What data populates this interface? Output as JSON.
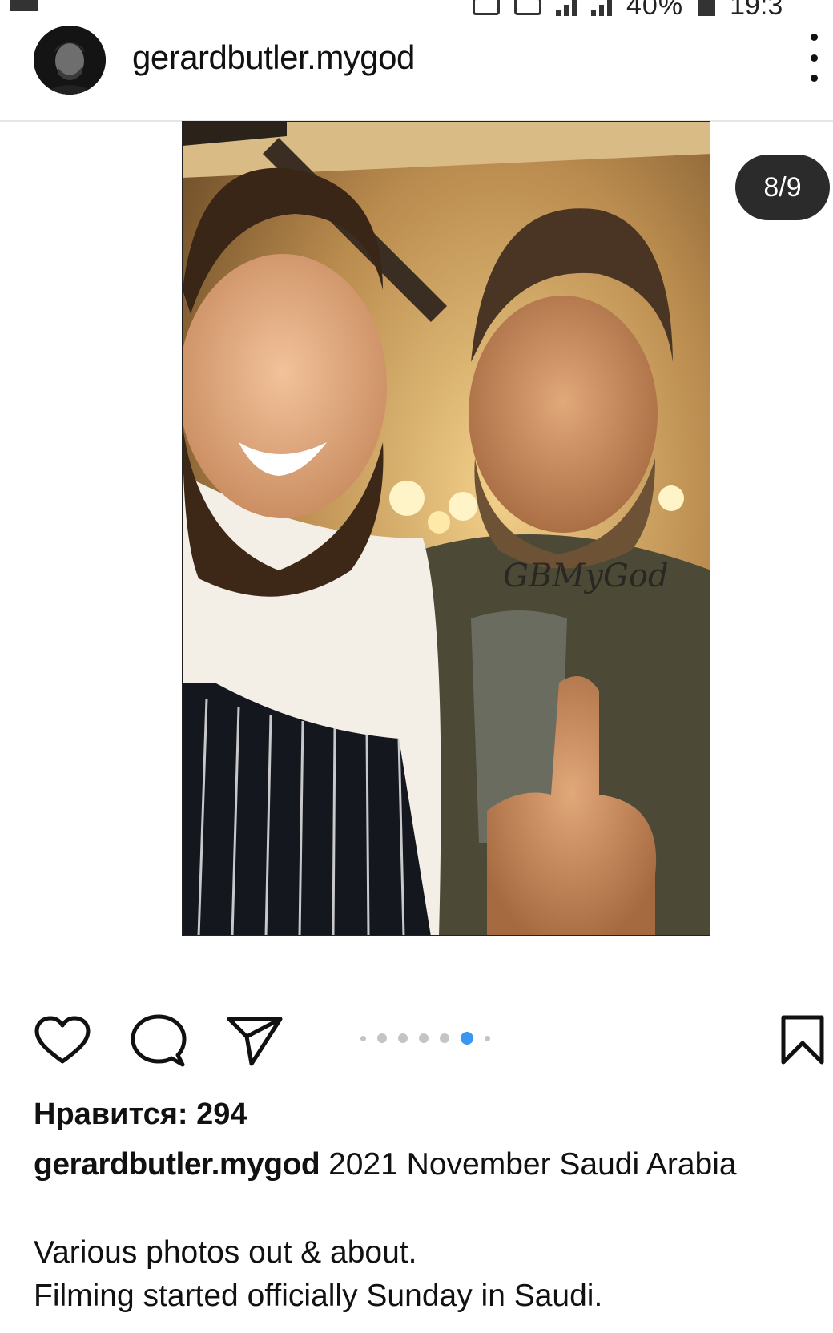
{
  "status_bar": {
    "battery_percent": "40%",
    "time": "19:3"
  },
  "header": {
    "username": "gerardbutler.mygod"
  },
  "post": {
    "image_counter": "8/9",
    "watermark": "GBMyGod",
    "carousel": {
      "total_dots": 7,
      "active_index": 5
    },
    "likes_text": "Нравится: 294",
    "caption": {
      "username": "gerardbutler.mygod",
      "first_line": "2021 November Saudi Arabia",
      "line2": "Various photos out & about.",
      "line3": "Filming started officially Sunday in Saudi."
    }
  },
  "colors": {
    "accent": "#3897f0",
    "counter_bg": "#2b2b2b",
    "text": "#111111"
  },
  "icons": [
    "more-icon",
    "heart-icon",
    "comment-icon",
    "share-icon",
    "bookmark-icon"
  ]
}
